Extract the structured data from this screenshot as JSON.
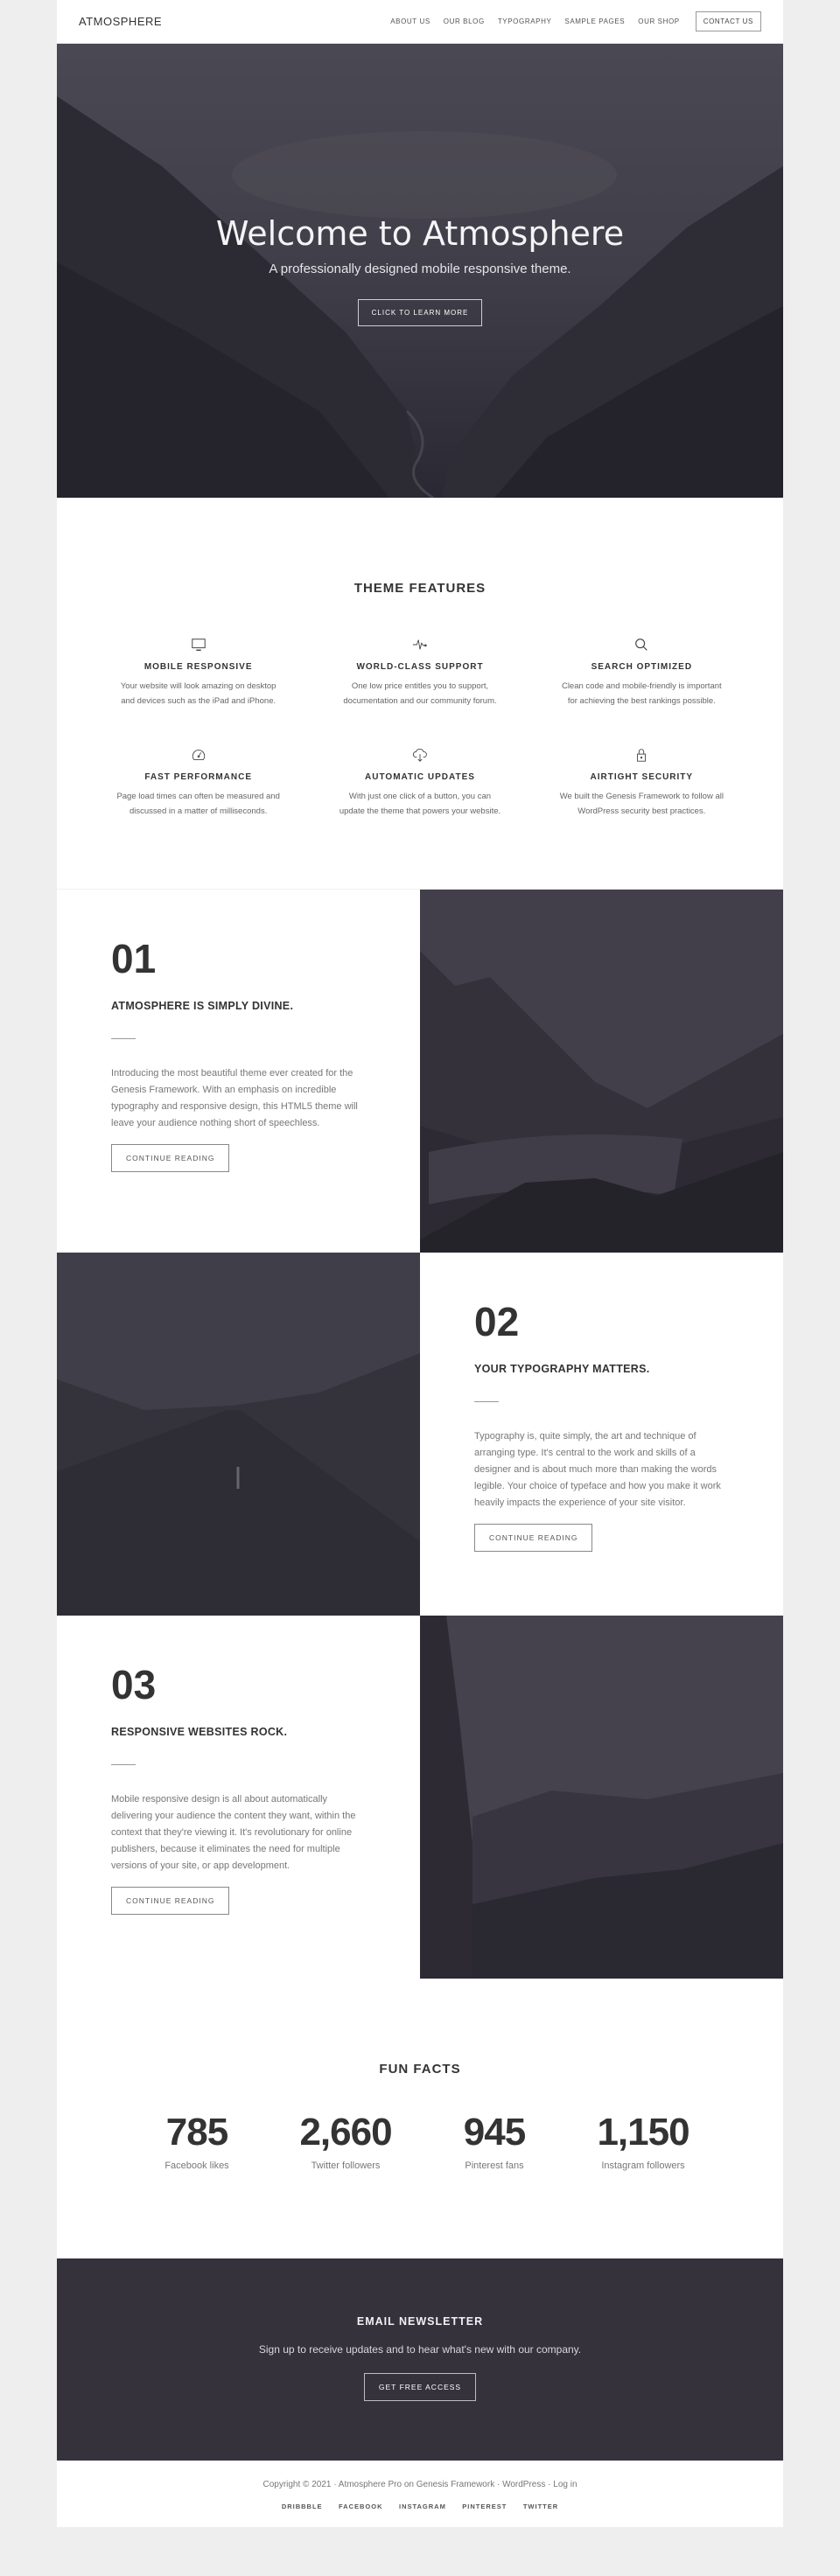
{
  "header": {
    "logo": "ATMOSPHERE",
    "nav": [
      {
        "label": "ABOUT US"
      },
      {
        "label": "OUR BLOG"
      },
      {
        "label": "TYPOGRAPHY"
      },
      {
        "label": "SAMPLE PAGES"
      },
      {
        "label": "OUR SHOP"
      }
    ],
    "contact_button": "CONTACT US"
  },
  "hero": {
    "title": "Welcome to Atmosphere",
    "subtitle": "A professionally designed mobile responsive theme.",
    "button": "CLICK TO LEARN MORE"
  },
  "features": {
    "title": "THEME FEATURES",
    "items": [
      {
        "icon": "monitor-icon",
        "title": "MOBILE RESPONSIVE",
        "desc1": "Your website will look amazing on desktop",
        "desc2": "and devices such as the iPad and iPhone."
      },
      {
        "icon": "pulse-icon",
        "title": "WORLD-CLASS SUPPORT",
        "desc1": "One low price entitles you to support,",
        "desc2": "documentation and our community forum."
      },
      {
        "icon": "search-icon",
        "title": "SEARCH OPTIMIZED",
        "desc1": "Clean code and mobile-friendly is important",
        "desc2": "for achieving the best rankings possible."
      },
      {
        "icon": "speedometer-icon",
        "title": "FAST PERFORMANCE",
        "desc1": "Page load times can often be measured and",
        "desc2": "discussed in a matter of milliseconds."
      },
      {
        "icon": "cloud-download-icon",
        "title": "AUTOMATIC UPDATES",
        "desc1": "With just one click of a button, you can",
        "desc2": "update the theme that powers your website."
      },
      {
        "icon": "lock-icon",
        "title": "AIRTIGHT SECURITY",
        "desc1": "We built the Genesis Framework to follow all",
        "desc2": "WordPress security best practices."
      }
    ]
  },
  "blocks": [
    {
      "number": "01",
      "title": "ATMOSPHERE IS SIMPLY DIVINE.",
      "desc": "Introducing the most beautiful theme ever created for the Genesis Framework. With an emphasis on incredible typography and responsive design, this HTML5 theme will leave your audience nothing short of speechless.",
      "button": "CONTINUE READING",
      "image": "mountain-lake"
    },
    {
      "number": "02",
      "title": "YOUR TYPOGRAPHY MATTERS.",
      "desc": "Typography is, quite simply, the art and technique of arranging type. It's central to the work and skills of a designer and is about much more than making the words legible. Your choice of typeface and how you make it work heavily impacts the experience of your site visitor.",
      "button": "CONTINUE READING",
      "image": "open-road"
    },
    {
      "number": "03",
      "title": "RESPONSIVE WEBSITES ROCK.",
      "desc": "Mobile responsive design is all about automatically delivering your audience the content they want, within the context that they're viewing it. It's revolutionary for online publishers, because it eliminates the need for multiple versions of your site, or app development.",
      "button": "CONTINUE READING",
      "image": "cliff-valley"
    }
  ],
  "facts": {
    "title": "FUN FACTS",
    "items": [
      {
        "value": "785",
        "label": "Facebook likes"
      },
      {
        "value": "2,660",
        "label": "Twitter followers"
      },
      {
        "value": "945",
        "label": "Pinterest fans"
      },
      {
        "value": "1,150",
        "label": "Instagram followers"
      }
    ]
  },
  "newsletter": {
    "title": "EMAIL NEWSLETTER",
    "desc": "Sign up to receive updates and to hear what's new with our company.",
    "button": "GET FREE ACCESS"
  },
  "footer": {
    "copyright_prefix": "Copyright © 2021 · ",
    "theme_link": "Atmosphere Pro",
    "on_text": " on ",
    "framework_link": "Genesis Framework",
    "sep1": " · ",
    "wp_link": "WordPress",
    "sep2": " · ",
    "login_link": "Log in",
    "social": [
      {
        "label": "DRIBBBLE"
      },
      {
        "label": "FACEBOOK"
      },
      {
        "label": "INSTAGRAM"
      },
      {
        "label": "PINTEREST"
      },
      {
        "label": "TWITTER"
      }
    ]
  },
  "colors": {
    "page_bg": "#eeeeee",
    "dark_band": "#35323c",
    "text": "#333333",
    "muted": "#777777"
  }
}
